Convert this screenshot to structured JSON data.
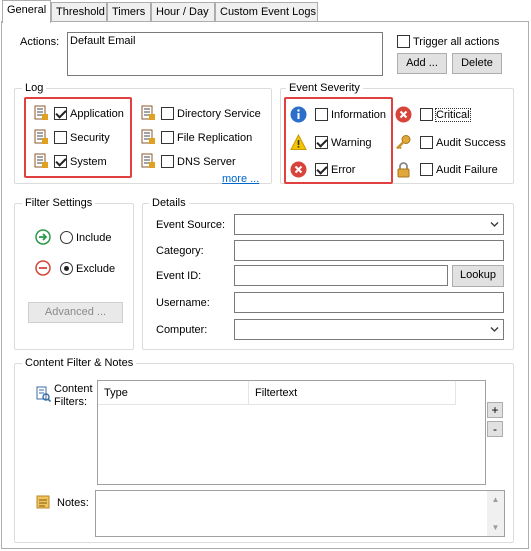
{
  "tabs": [
    "General",
    "Threshold",
    "Timers",
    "Hour / Day",
    "Custom Event Logs"
  ],
  "actions": {
    "label": "Actions:",
    "list_value": "Default Email",
    "trigger_all_label": "Trigger all actions",
    "trigger_all_checked": false,
    "add_label": "Add ...",
    "delete_label": "Delete"
  },
  "log": {
    "title": "Log",
    "items": [
      {
        "label": "Application",
        "checked": true
      },
      {
        "label": "Security",
        "checked": false
      },
      {
        "label": "System",
        "checked": true
      },
      {
        "label": "Directory Service",
        "checked": false
      },
      {
        "label": "File Replication",
        "checked": false
      },
      {
        "label": "DNS Server",
        "checked": false
      }
    ],
    "more_label": "more ..."
  },
  "severity": {
    "title": "Event Severity",
    "items": [
      {
        "label": "Information",
        "checked": false,
        "icon": "info-icon"
      },
      {
        "label": "Warning",
        "checked": true,
        "icon": "warning-icon"
      },
      {
        "label": "Error",
        "checked": true,
        "icon": "error-icon"
      },
      {
        "label": "Critical",
        "checked": false,
        "icon": "critical-icon"
      },
      {
        "label": "Audit Success",
        "checked": false,
        "icon": "key-icon"
      },
      {
        "label": "Audit Failure",
        "checked": false,
        "icon": "lock-icon"
      }
    ]
  },
  "filter": {
    "title": "Filter Settings",
    "include_label": "Include",
    "exclude_label": "Exclude",
    "selected": "exclude",
    "advanced_label": "Advanced ..."
  },
  "details": {
    "title": "Details",
    "event_source_label": "Event Source:",
    "category_label": "Category:",
    "event_id_label": "Event ID:",
    "lookup_label": "Lookup",
    "username_label": "Username:",
    "computer_label": "Computer:"
  },
  "content": {
    "title": "Content Filter & Notes",
    "filters_label": "Content\nFilters:",
    "col_type": "Type",
    "col_filtertext": "Filtertext",
    "add_label": "+",
    "remove_label": "-",
    "notes_label": "Notes:"
  },
  "colors": {
    "highlight": "#e04040",
    "info_blue": "#2a6fc9",
    "error_red": "#d9443a",
    "warning_yellow": "#f5c400"
  }
}
